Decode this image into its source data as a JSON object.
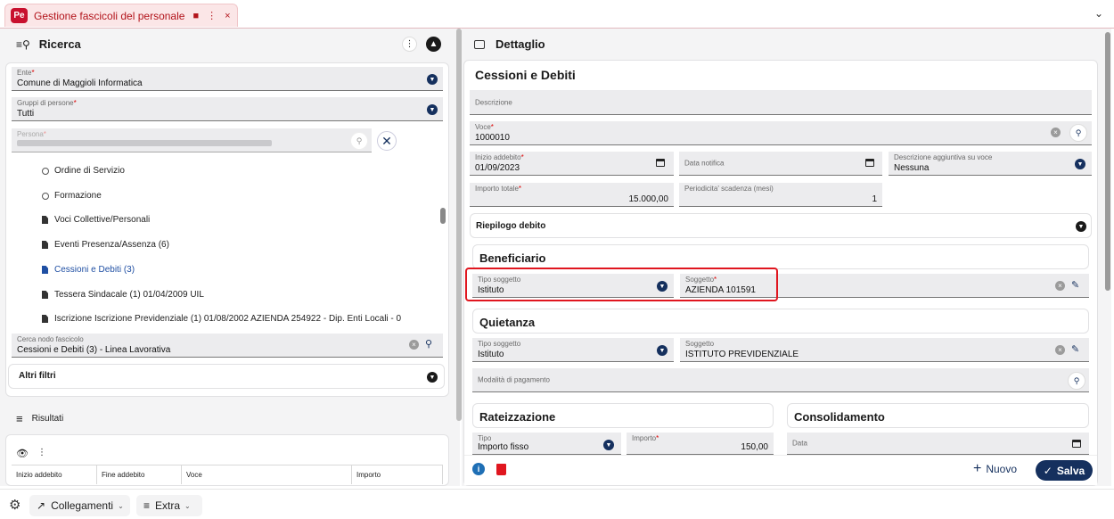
{
  "tab": {
    "logo": "Pe",
    "title": "Gestione fascicoli del personale",
    "bookmark_icon": "bookmark-icon",
    "menu_icon": "⋮",
    "close_icon": "×"
  },
  "left": {
    "title": "Ricerca",
    "ente": {
      "label": "Ente",
      "value": "Comune di Maggioli Informatica"
    },
    "gruppi": {
      "label": "Gruppi di persone",
      "value": "Tutti"
    },
    "persona": {
      "label": "Persona"
    },
    "tree": [
      {
        "label": "Ordine di Servizio",
        "type": "circle"
      },
      {
        "label": "Formazione",
        "type": "circle"
      },
      {
        "label": "Voci Collettive/Personali",
        "type": "doc"
      },
      {
        "label": "Eventi Presenza/Assenza (6)",
        "type": "doc"
      },
      {
        "label": "Cessioni e Debiti (3)",
        "type": "doc",
        "selected": true
      },
      {
        "label": "Tessera Sindacale (1) 01/04/2009 UIL",
        "type": "doc"
      },
      {
        "label": "Iscrizione Iscrizione Previdenziale (1) 01/08/2002 AZIENDA 254922 - Dip. Enti Locali - 0",
        "type": "doc"
      }
    ],
    "cerca": {
      "label": "Cerca nodo fascicolo",
      "value": "Cessioni e Debiti (3) - Linea Lavorativa"
    },
    "altri_filtri": "Altri filtri",
    "risultati": "Risultati",
    "columns": [
      "Inizio addebito",
      "Fine addebito",
      "Voce",
      "Importo"
    ]
  },
  "right": {
    "title": "Dettaglio",
    "heading": "Cessioni e Debiti",
    "descrizione": "Descrizione",
    "voce": {
      "label": "Voce",
      "value": "1000010"
    },
    "inizio": {
      "label": "Inizio addebito",
      "value": "01/09/2023"
    },
    "data_notifica": "Data notifica",
    "desc_agg": {
      "label": "Descrizione aggiuntiva su voce",
      "value": "Nessuna"
    },
    "importo_totale": {
      "label": "Importo totale",
      "value": "15.000,00"
    },
    "periodicita": {
      "label": "Periodicita' scadenza (mesi)",
      "value": "1"
    },
    "riepilogo": "Riepilogo debito",
    "beneficiario": {
      "title": "Beneficiario",
      "tipo": {
        "label": "Tipo soggetto",
        "value": "Istituto"
      },
      "soggetto": {
        "label": "Soggetto",
        "value": "AZIENDA 101591"
      }
    },
    "quietanza": {
      "title": "Quietanza",
      "tipo": {
        "label": "Tipo soggetto",
        "value": "Istituto"
      },
      "soggetto": {
        "label": "Soggetto",
        "value": "ISTITUTO PREVIDENZIALE"
      },
      "modalita": "Modalità di pagamento"
    },
    "rateizzazione": {
      "title": "Rateizzazione",
      "tipo": {
        "label": "Tipo",
        "value": "Importo fisso"
      },
      "importo": {
        "label": "Importo",
        "value": "150,00"
      }
    },
    "consolidamento": {
      "title": "Consolidamento",
      "data": "Data"
    },
    "nuovo": "Nuovo",
    "salva": "Salva"
  },
  "bottom": {
    "collegamenti": "Collegamenti",
    "extra": "Extra"
  },
  "colors": {
    "brand": "#c8102e",
    "primary": "#15305e",
    "highlight": "#e0161f"
  }
}
